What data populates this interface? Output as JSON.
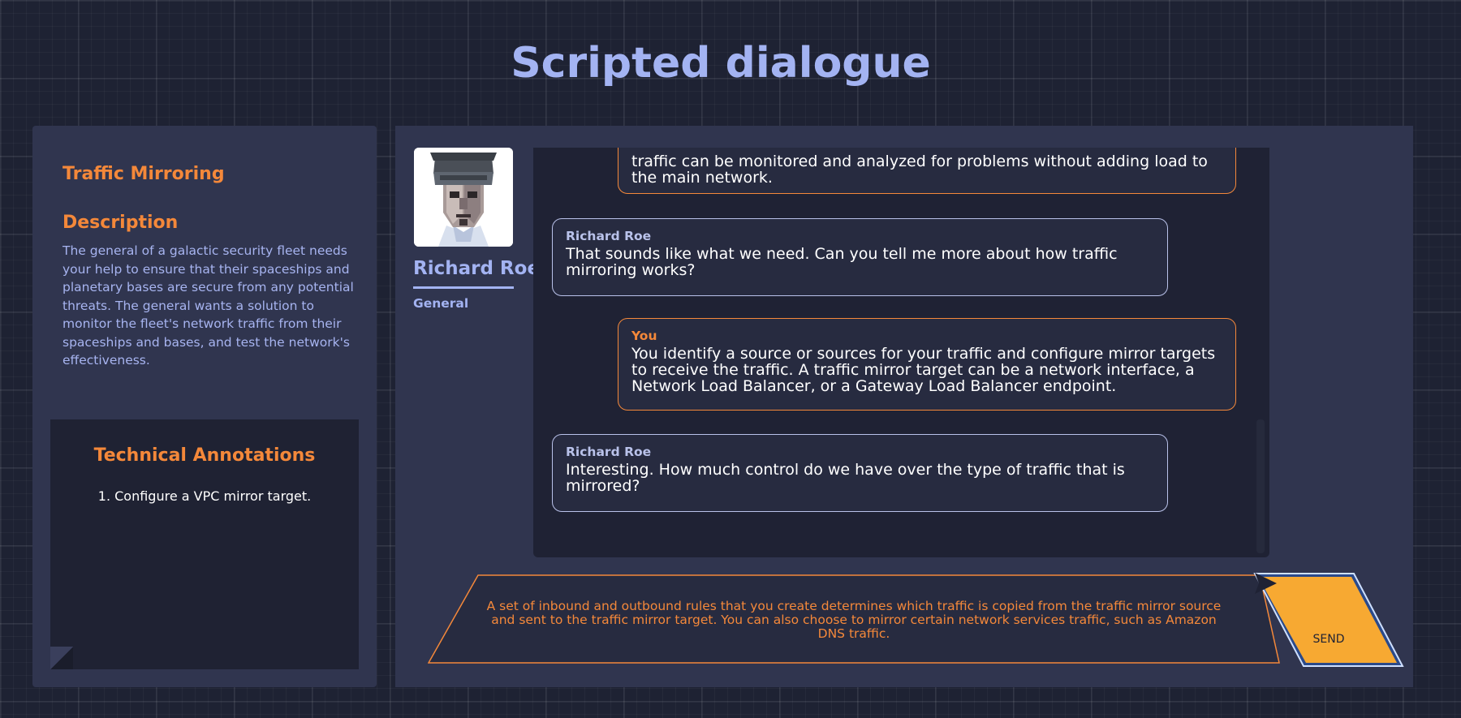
{
  "page": {
    "title": "Scripted dialogue"
  },
  "mission": {
    "title": "Traffic Mirroring",
    "description_heading": "Description",
    "description": "The general of a galactic security fleet needs your help to ensure that their spaceships and planetary bases are secure from any potential threats. The general wants a solution to monitor the fleet's network traffic from their spaceships and bases, and test the network's effectiveness.",
    "annotations_heading": "Technical Annotations",
    "annotations": [
      "1. Configure a VPC mirror target."
    ]
  },
  "npc": {
    "name": "Richard Roe",
    "role": "General"
  },
  "messages": [
    {
      "speaker": "",
      "text": "traffic can be monitored and analyzed for problems without adding load to the main network."
    },
    {
      "speaker": "Richard Roe",
      "text": "That sounds like what we need. Can you tell me more about how traffic mirroring works?"
    },
    {
      "speaker": "You",
      "text": "You identify a source or sources for your traffic and configure mirror targets to receive the traffic. A traffic mirror target can be a network interface, a Network Load Balancer, or a Gateway Load Balancer endpoint."
    },
    {
      "speaker": "Richard Roe",
      "text": "Interesting. How much control do we have over the type of traffic that is mirrored?"
    }
  ],
  "response": {
    "text": "A set of inbound and outbound rules that you create determines which traffic is copied from the traffic mirror source and sent to the traffic mirror target. You can also choose to mirror certain network services traffic, such as Amazon DNS traffic."
  },
  "send_button": {
    "label": "SEND",
    "icon": "send-arrow-icon"
  },
  "colors": {
    "accent": "#f4883a",
    "primary": "#a3b3f2",
    "panel": "#30354f",
    "send": "#f7a932"
  }
}
